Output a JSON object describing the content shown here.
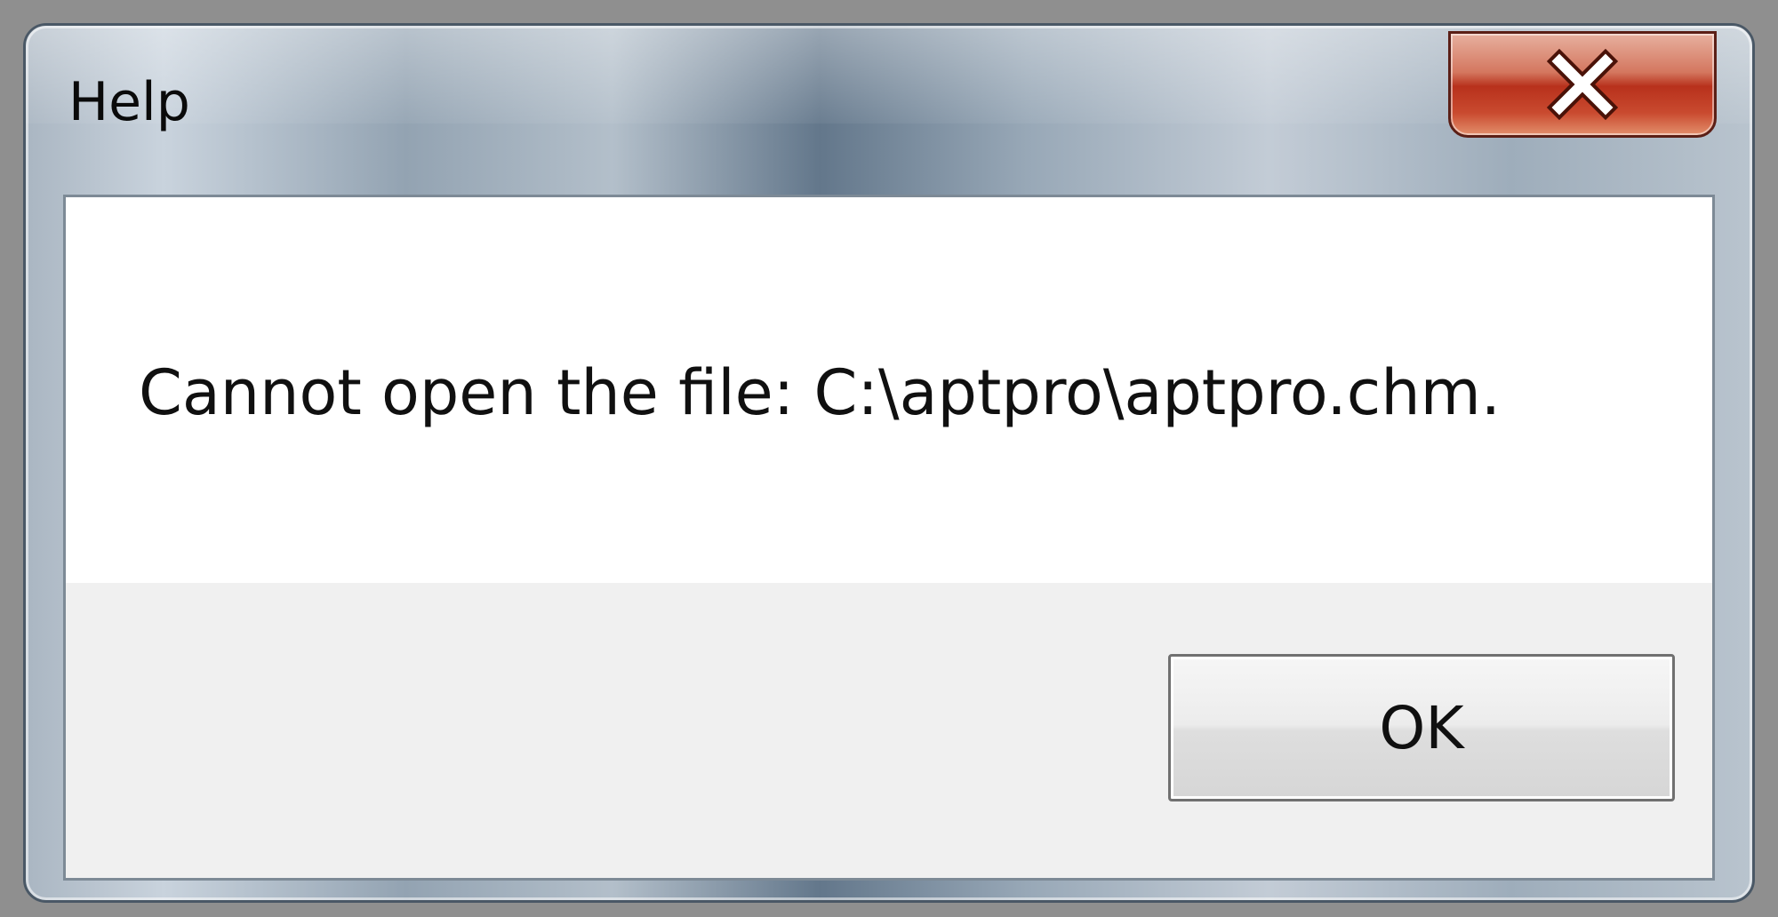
{
  "window": {
    "title": "Help"
  },
  "title_bar": {
    "close_icon": "close-x-icon",
    "close_color": "#c0392b"
  },
  "dialog": {
    "message": "Cannot open the file: C:\\aptpro\\aptpro.chm.",
    "ok_label": "OK"
  }
}
